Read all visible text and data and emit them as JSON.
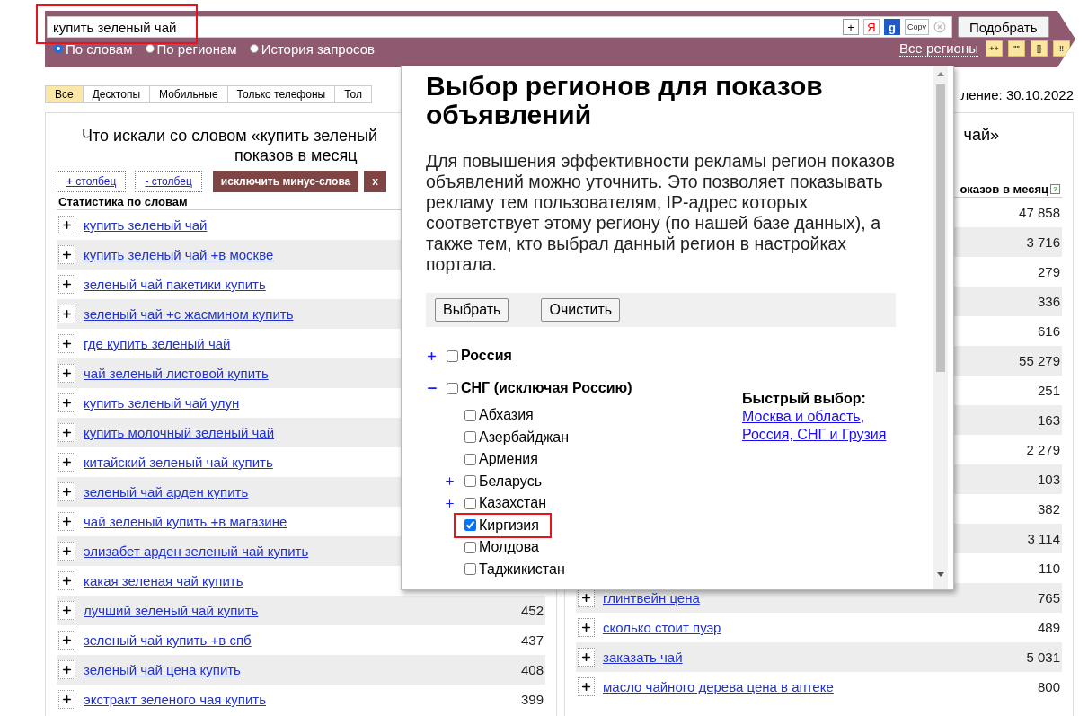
{
  "search": {
    "value": "купить зеленый чай",
    "button": "Подобрать",
    "tools": [
      {
        "label": "+",
        "kind": "plain"
      },
      {
        "label": "Я",
        "kind": "yandex"
      },
      {
        "label": "g",
        "kind": "google"
      },
      {
        "label": "Copy",
        "kind": "copy"
      }
    ]
  },
  "modes": [
    {
      "label": "По словам",
      "selected": true
    },
    {
      "label": "По регионам",
      "selected": false
    },
    {
      "label": "История запросов",
      "selected": false
    }
  ],
  "regions_link": "Все регионы",
  "quick_buttons": [
    "++",
    "\"\"",
    "[]",
    "!!"
  ],
  "device_tabs": [
    {
      "label": "Все",
      "selected": true
    },
    {
      "label": "Десктопы",
      "selected": false
    },
    {
      "label": "Мобильные",
      "selected": false
    },
    {
      "label": "Только телефоны",
      "selected": false
    },
    {
      "label": "Тол",
      "selected": false
    }
  ],
  "updated": "ление: 30.10.2022",
  "left_panel": {
    "title_lines": [
      "Что искали со словом «купить зеленый",
      "показов в месяц"
    ],
    "add_column": "**+** столбец",
    "remove_column": "**-** столбец",
    "exclude_button": "исключить минус-слова",
    "close_button": "x",
    "column_header": "Статистика по словам",
    "rows": [
      {
        "keyword": "купить зеленый чай"
      },
      {
        "keyword": "купить зеленый чай +в москве"
      },
      {
        "keyword": "зеленый чай пакетики купить"
      },
      {
        "keyword": "зеленый чай +с жасмином купить"
      },
      {
        "keyword": "где купить зеленый чай"
      },
      {
        "keyword": "чай зеленый листовой купить"
      },
      {
        "keyword": "купить зеленый чай улун"
      },
      {
        "keyword": "купить молочный зеленый чай"
      },
      {
        "keyword": "китайский зеленый чай купить"
      },
      {
        "keyword": "зеленый чай арден купить"
      },
      {
        "keyword": "чай зеленый купить +в магазине"
      },
      {
        "keyword": "элизабет арден зеленый чай купить"
      },
      {
        "keyword": "какая зеленая чай купить"
      },
      {
        "keyword": "лучший зеленый чай купить",
        "count": "452"
      },
      {
        "keyword": "зеленый чай купить +в спб",
        "count": "437"
      },
      {
        "keyword": "зеленый чай цена купить",
        "count": "408"
      },
      {
        "keyword": "экстракт зеленого чая купить",
        "count": "399"
      }
    ]
  },
  "right_panel": {
    "title": "чай»",
    "column_header": "оказов в месяц",
    "help": "?",
    "rows": [
      {
        "count": "47 858"
      },
      {
        "count": "3 716"
      },
      {
        "count": "279"
      },
      {
        "count": "336"
      },
      {
        "count": "616"
      },
      {
        "count": "55 279"
      },
      {
        "count": "251"
      },
      {
        "count": "163"
      },
      {
        "count": "2 279"
      },
      {
        "count": "103"
      },
      {
        "count": "382"
      },
      {
        "count": "3 114"
      },
      {
        "count": "110"
      },
      {
        "keyword": "глинтвейн цена",
        "count": "765"
      },
      {
        "keyword": "сколько стоит пуэр",
        "count": "489"
      },
      {
        "keyword": "заказать чай",
        "count": "5 031"
      },
      {
        "keyword": "масло чайного дерева цена в аптеке",
        "count": "800"
      }
    ]
  },
  "region_dialog": {
    "title": "Выбор регионов для показов объявлений",
    "description": "Для повышения эффективности рекламы регион показов объявлений можно уточнить. Это позволяет показывать рекламу тем пользователям, IP-адрес которых соответствует этому региону (по нашей базе данных), а также тем, кто выбрал данный регион в настройках портала.",
    "buttons": [
      "Выбрать",
      "Очистить"
    ],
    "tree": [
      {
        "label": "Россия",
        "kind": "branch",
        "expanded": false,
        "checked": false
      },
      {
        "label": "СНГ (исключая Россию)",
        "kind": "branch",
        "expanded": true,
        "checked": false,
        "children": [
          {
            "label": "Абхазия",
            "kind": "leaf",
            "checked": false
          },
          {
            "label": "Азербайджан",
            "kind": "leaf",
            "checked": false
          },
          {
            "label": "Армения",
            "kind": "leaf",
            "checked": false
          },
          {
            "label": "Беларусь",
            "kind": "branch",
            "expanded": false,
            "checked": false
          },
          {
            "label": "Казахстан",
            "kind": "branch",
            "expanded": false,
            "checked": false
          },
          {
            "label": "Киргизия",
            "kind": "leaf",
            "checked": true,
            "highlighted": true
          },
          {
            "label": "Молдова",
            "kind": "leaf",
            "checked": false
          },
          {
            "label": "Таджикистан",
            "kind": "leaf",
            "checked": false
          }
        ]
      }
    ],
    "quick_select": {
      "label": "Быстрый выбор:",
      "links": [
        "Москва и область",
        "Россия, СНГ и Грузия"
      ],
      "separator": ","
    }
  }
}
